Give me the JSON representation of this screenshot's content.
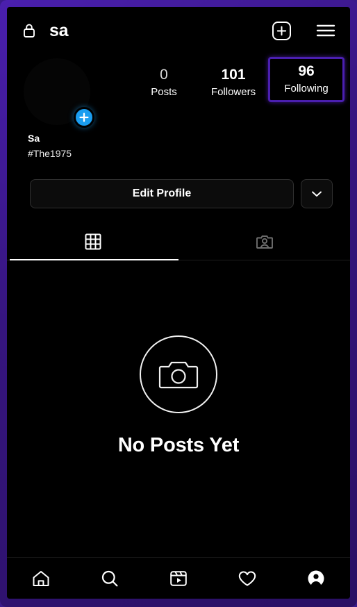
{
  "header": {
    "lock_icon": "lock-icon",
    "username": "sa",
    "add_icon": "plus-square-icon",
    "menu_icon": "hamburger-menu-icon"
  },
  "profile": {
    "avatar_icon": "avatar-image",
    "add_story_icon": "plus-icon",
    "stats": [
      {
        "value": "0",
        "label": "Posts",
        "highlighted": false
      },
      {
        "value": "101",
        "label": "Followers",
        "highlighted": false
      },
      {
        "value": "96",
        "label": "Following",
        "highlighted": true
      }
    ],
    "display_name": "Sa",
    "bio": "#The1975"
  },
  "actions": {
    "edit_profile_label": "Edit Profile",
    "dropdown_icon": "chevron-down-icon"
  },
  "tabs": [
    {
      "name": "grid",
      "icon": "grid-icon",
      "active": true
    },
    {
      "name": "tagged",
      "icon": "tagged-person-icon",
      "active": false
    }
  ],
  "empty_state": {
    "icon": "camera-circle-icon",
    "title": "No Posts Yet"
  },
  "bottom_nav": [
    {
      "name": "home",
      "icon": "home-icon",
      "active": false
    },
    {
      "name": "search",
      "icon": "search-icon",
      "active": false
    },
    {
      "name": "reels",
      "icon": "reels-icon",
      "active": false
    },
    {
      "name": "activity",
      "icon": "heart-icon",
      "active": false
    },
    {
      "name": "profile",
      "icon": "profile-avatar-icon",
      "active": true
    }
  ],
  "colors": {
    "frame_purple": "#4a1fae",
    "highlight_border": "#4a1fb0",
    "add_badge_blue": "#1a9df0",
    "background": "#000000",
    "text": "#ffffff"
  }
}
